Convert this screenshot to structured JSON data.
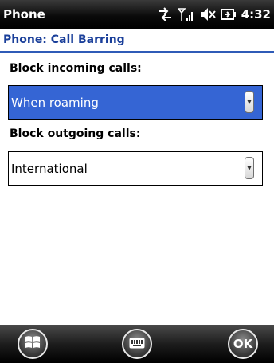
{
  "status_bar": {
    "app_title": "Phone",
    "time": "4:32",
    "icons": [
      "data-sync-icon",
      "signal-strength-icon",
      "volume-muted-icon",
      "battery-charging-icon"
    ]
  },
  "header": {
    "title": "Phone: Call Barring"
  },
  "form": {
    "incoming": {
      "label": "Block incoming calls:",
      "value": "When roaming",
      "selected": true
    },
    "outgoing": {
      "label": "Block outgoing calls:",
      "value": "International",
      "selected": false
    }
  },
  "toolbar": {
    "left": "start-windows-icon",
    "center": "keyboard-icon",
    "ok_label": "OK"
  },
  "colors": {
    "header_text": "#1a3f9a",
    "selection": "#3565d4",
    "status_bar": "#000000"
  }
}
